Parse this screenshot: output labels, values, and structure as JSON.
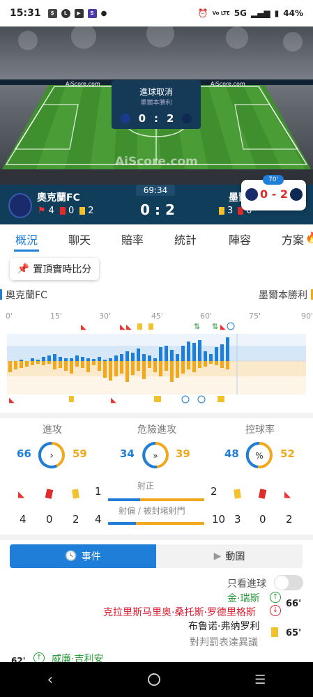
{
  "status": {
    "time": "15:31",
    "network": "5G",
    "volte": "Vo LTE",
    "battery": "44%"
  },
  "pitch": {
    "watermark": "AiScore.com",
    "ad_text": "AiScore.com",
    "overlay_title": "進球取消",
    "overlay_sub": "墨爾本勝利",
    "overlay_score_home": "0",
    "overlay_sep": ":",
    "overlay_score_away": "2"
  },
  "match": {
    "home": "奧克蘭FC",
    "away": "墨爾",
    "clock": "69:34",
    "score": "0 : 2",
    "home_corners": "4",
    "home_red": "0",
    "home_yellow": "2",
    "away_yellow": "3",
    "away_red": "0"
  },
  "mini": {
    "minute": "70'",
    "score": "0 - 2"
  },
  "tabs": [
    {
      "label": "概況"
    },
    {
      "label": "聊天"
    },
    {
      "label": "賠率"
    },
    {
      "label": "統計"
    },
    {
      "label": "陣容"
    },
    {
      "label": "方案"
    }
  ],
  "pin_label": "置頂實時比分",
  "teams": {
    "home": "奧克蘭FC",
    "away": "墨爾本勝利"
  },
  "timeline": {
    "ticks": [
      "0'",
      "15'",
      "30'",
      "45'",
      "60'",
      "75'",
      "90'"
    ]
  },
  "stats": {
    "circles": [
      {
        "label": "進攻",
        "home": "66",
        "away": "59"
      },
      {
        "label": "危險進攻",
        "home": "34",
        "away": "39"
      },
      {
        "label": "控球率",
        "home": "48",
        "away": "52"
      }
    ],
    "home_corners": "4",
    "home_red": "0",
    "home_yellow": "2",
    "away_corners": "2",
    "away_red": "0",
    "away_yellow": "3",
    "on_target": {
      "label": "射正",
      "home": "1",
      "away": "2"
    },
    "off_target": {
      "label": "射偏 / 被封堵射門",
      "home": "4",
      "away": "10"
    }
  },
  "events": {
    "tab_events": "事件",
    "tab_anim": "動圖",
    "only_goals": "只看進球",
    "items": [
      {
        "text": "金·瑞斯",
        "minute": ""
      },
      {
        "text": "克拉里斯马里奥·桑托斯·罗德里格斯",
        "minute": "66'"
      },
      {
        "text": "布鲁诺·弗纳罗利",
        "minute": ""
      },
      {
        "text": "對判罰表達異議",
        "minute": "65'"
      },
      {
        "text": "威廉·吉利安",
        "minute": "62'"
      }
    ]
  },
  "colors": {
    "home": "#1e7ed8",
    "away": "#f2a81d",
    "header": "#0f3d5a"
  }
}
